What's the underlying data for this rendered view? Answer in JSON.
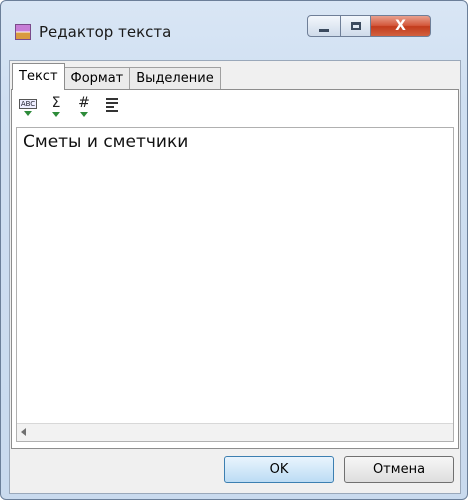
{
  "window": {
    "title": "Редактор текста",
    "close_glyph": "X"
  },
  "tabs": [
    {
      "label": "Текст",
      "active": true
    },
    {
      "label": "Формат",
      "active": false
    },
    {
      "label": "Выделение",
      "active": false
    }
  ],
  "toolbar": {
    "spellcheck_glyph": "ABC",
    "sum_glyph": "Σ",
    "number_glyph": "#",
    "icons": [
      "spellcheck-icon",
      "sum-icon",
      "number-icon",
      "align-icon"
    ]
  },
  "editor": {
    "content": "Сметы и сметчики"
  },
  "buttons": {
    "ok": "OK",
    "cancel": "Отмена"
  },
  "colors": {
    "title_bar": "#cfdff1",
    "close_button": "#d4573b",
    "ok_button": "#bcdcf4",
    "toolbar_arrow": "#2e8b3a"
  }
}
